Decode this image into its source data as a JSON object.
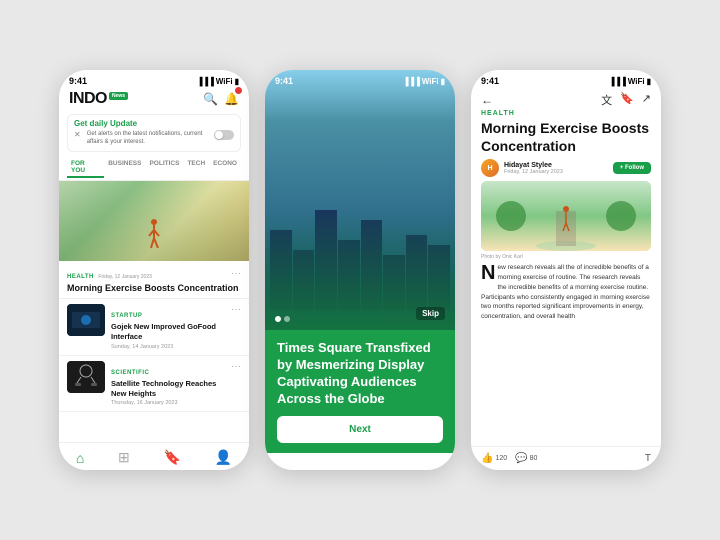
{
  "phones": {
    "left": {
      "statusTime": "9:41",
      "logo": "INDO",
      "logoNews": "News",
      "dailyUpdate": {
        "title": "Get daily Update",
        "text": "Get alerts on the latest notifications, current affairs & your interest."
      },
      "navTabs": [
        "FOR YOU",
        "BUSINESS",
        "POLITICS",
        "TECH",
        "ECONO"
      ],
      "activeTab": "FOR YOU",
      "mainArticle": {
        "label": "HEALTH",
        "date": "Friday, 12 January 2023",
        "title": "Morning Exercise Boosts Concentration"
      },
      "articles": [
        {
          "label": "STARTUP",
          "title": "Gojek New Improved GoFood Interface",
          "date": "Sunday, 14 January 2023"
        },
        {
          "label": "SCIENTIFIC",
          "title": "Satellite Technology Reaches New Heights",
          "date": "Thursday, 16 January 2023"
        }
      ],
      "bottomNav": [
        "home",
        "grid",
        "bookmark",
        "user"
      ]
    },
    "center": {
      "statusTime": "9:41",
      "headline": "Times Square Transfixed by Mesmerizing Display Captivating Audiences Across the Globe",
      "skipLabel": "Skip",
      "nextLabel": "Next"
    },
    "right": {
      "statusTime": "9:41",
      "healthLabel": "HEALTH",
      "title": "Morning Exercise Boosts Concentration",
      "author": {
        "name": "Hidayat Stylee",
        "date": "Friday, 12 January 2023",
        "initials": "H"
      },
      "followLabel": "+ Follow",
      "photoCredit": "Photo by Onic Karl",
      "bodyText": "ew research reveals all the of incredible benefits of a morning exercise of routine. The research reveals the incredible benefits of a morning exercise routine. Participants who consistently engaged in morning exercise two months reported significant improvements in energy, concentration, and overall health",
      "likes": "120",
      "comments": "80"
    }
  }
}
